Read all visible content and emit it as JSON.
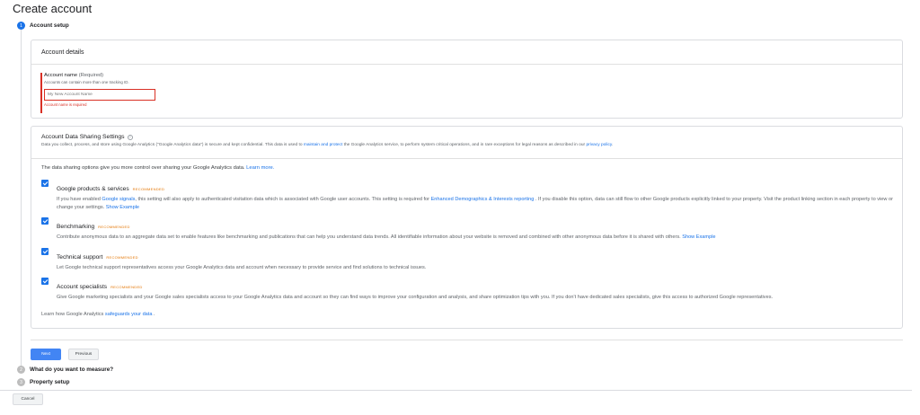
{
  "page": {
    "title": "Create account"
  },
  "steps": [
    {
      "number": "1",
      "label": "Account setup"
    },
    {
      "number": "2",
      "label": "What do you want to measure?"
    },
    {
      "number": "3",
      "label": "Property setup"
    }
  ],
  "account_details": {
    "header": "Account details",
    "field_label": "Account name",
    "field_required": "(Required)",
    "field_help": "Accounts can contain more than one tracking ID.",
    "field_placeholder": "My New Account Name",
    "field_value": "",
    "field_error": "Account name is required"
  },
  "sharing": {
    "title": "Account Data Sharing Settings",
    "help_icon": "?",
    "desc_prefix": "Data you collect, process, and store using Google Analytics (\"Google Analytics data\") is secure and kept confidential. This data is used to ",
    "desc_link1": "maintain and protect",
    "desc_middle": " the Google Analytics service, to perform system critical operations, and in rare exceptions for legal reasons as described in our ",
    "desc_link2": "privacy policy",
    "desc_suffix": ".",
    "intro_text": "The data sharing options give you more control over sharing your Google Analytics data. ",
    "intro_link": "Learn more.",
    "options": [
      {
        "title": "Google products & services",
        "badge": "RECOMMENDED",
        "checked": true,
        "desc_a": "If you have enabled ",
        "link_a": "Google signals",
        "desc_b": ", this setting will also apply to authenticated visitation data which is associated with Google user accounts. This setting is required for ",
        "link_b": "Enhanced Demographics & Interests reporting",
        "desc_c": " . If you disable this option, data can still flow to other Google products explicitly linked to your property. Visit the product linking section in each property to view or change your settings. ",
        "link_c": "Show Example"
      },
      {
        "title": "Benchmarking",
        "badge": "RECOMMENDED",
        "checked": true,
        "desc_a": "Contribute anonymous data to an aggregate data set to enable features like benchmarking and publications that can help you understand data trends. All identifiable information about your website is removed and combined with other anonymous data before it is shared with others. ",
        "link_a": "Show Example"
      },
      {
        "title": "Technical support",
        "badge": "RECOMMENDED",
        "checked": true,
        "desc_a": "Let Google technical support representatives access your Google Analytics data and account when necessary to provide service and find solutions to technical issues."
      },
      {
        "title": "Account specialists",
        "badge": "RECOMMENDED",
        "checked": true,
        "desc_a": "Give Google marketing specialists and your Google sales specialists access to your Google Analytics data and account so they can find ways to improve your configuration and analysis, and share optimization tips with you. If you don't have dedicated sales specialists, give this access to authorized Google representatives."
      }
    ],
    "learn_prefix": "Learn how Google Analytics ",
    "learn_link": "safeguards your data",
    "learn_suffix": " ."
  },
  "buttons": {
    "next": "Next",
    "previous": "Previous",
    "cancel": "Cancel"
  },
  "colors": {
    "accent": "#1a73e8",
    "error": "#d93025",
    "recommended": "#e37400"
  }
}
